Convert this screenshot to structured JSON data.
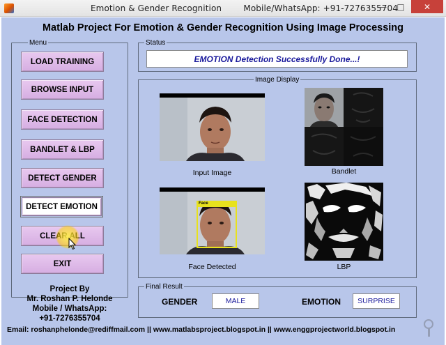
{
  "window": {
    "title": "Emotion & Gender Recognition        Mobile/WhatsApp: +91-7276355704",
    "minimize_glyph": "—",
    "maximize_glyph": "□",
    "close_glyph": "✕"
  },
  "header": {
    "title": "Matlab Project For Emotion & Gender Recognition Using Image Processing"
  },
  "menu": {
    "title": "Menu",
    "buttons": [
      {
        "label": "LOAD TRAINING"
      },
      {
        "label": "BROWSE INPUT"
      },
      {
        "label": "FACE DETECTION"
      },
      {
        "label": "BANDLET & LBP"
      },
      {
        "label": "DETECT GENDER"
      },
      {
        "label": "DETECT EMOTION"
      },
      {
        "label": "CLEAR ALL"
      },
      {
        "label": "EXIT"
      }
    ]
  },
  "status": {
    "title": "Status",
    "message": "EMOTION Detection Successfully Done...!"
  },
  "image_display": {
    "title": "Image Display",
    "captions": {
      "input": "Input Image",
      "bandlet": "Bandlet",
      "face": "Face Detected",
      "lbp": "LBP"
    },
    "face_box_label": "Face"
  },
  "result": {
    "title": "Final Result",
    "gender_label": "GENDER",
    "gender_value": "MALE",
    "emotion_label": "EMOTION",
    "emotion_value": "SURPRISE"
  },
  "credits": {
    "line1": "Project By",
    "line2": "Mr. Roshan P. Helonde",
    "line3": "Mobile / WhatsApp:",
    "line4": "+91-7276355704"
  },
  "footer": {
    "text": "Email: roshanphelonde@rediffmail.com ||  www.matlabsproject.blogspot.in || www.enggprojectworld.blogspot.in"
  },
  "colors": {
    "figure_bg": "#b8c6ea",
    "button_bg": "#d6aee2",
    "status_text": "#1a1a9c",
    "close_button": "#c7413a"
  }
}
